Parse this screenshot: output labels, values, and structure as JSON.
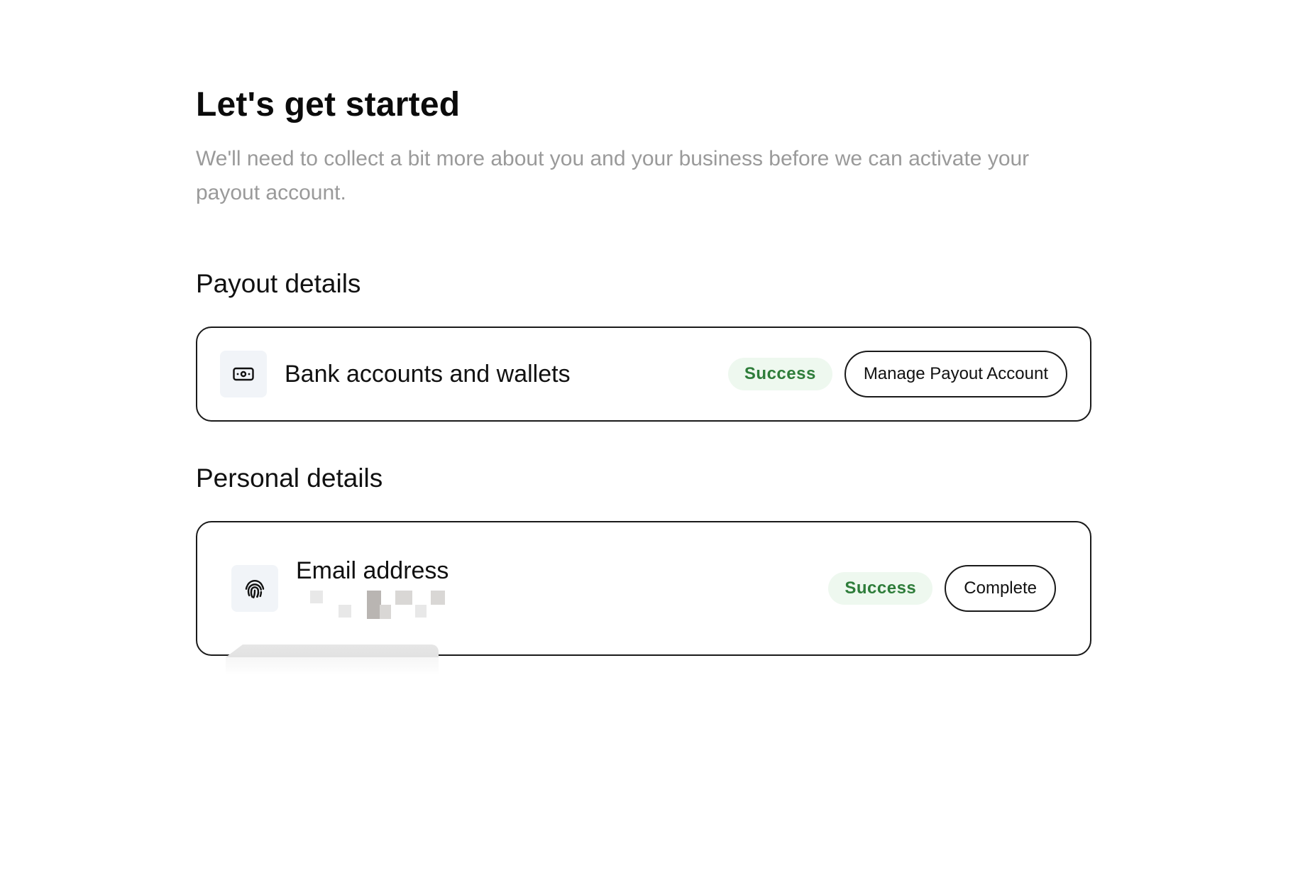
{
  "header": {
    "title": "Let's get started",
    "subtitle": "We'll need to collect a bit more about you and your business before we can activate your payout account."
  },
  "payout_section": {
    "title": "Payout details",
    "card": {
      "icon": "banknote-icon",
      "label": "Bank accounts and wallets",
      "status": "Success",
      "action_label": "Manage Payout Account"
    }
  },
  "personal_section": {
    "title": "Personal details",
    "card": {
      "icon": "fingerprint-icon",
      "label": "Email address",
      "status": "Success",
      "action_label": "Complete"
    }
  },
  "colors": {
    "success_text": "#2e7d3a",
    "success_bg": "#eef8ef",
    "border": "#1a1a1a",
    "icon_bg": "#f1f4f8",
    "muted_text": "#9a9a9a"
  }
}
